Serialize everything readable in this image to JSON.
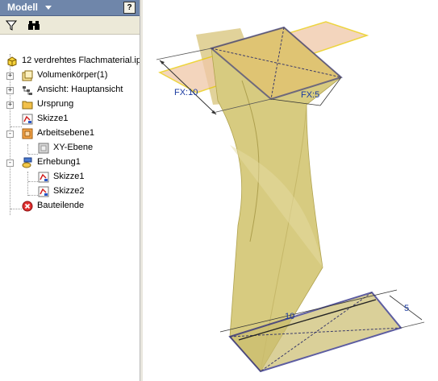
{
  "panel": {
    "title": "Modell",
    "help_label": "?",
    "toolbar": {
      "filter_icon": "filter-icon",
      "find_icon": "binoculars-icon"
    }
  },
  "tree": {
    "root": "12 verdrehtes Flachmaterial.ipt",
    "items": [
      {
        "label": "Volumenkörper(1)",
        "icon": "solid-bodies-icon",
        "expander": "+"
      },
      {
        "label": "Ansicht: Hauptansicht",
        "icon": "view-icon",
        "expander": "+"
      },
      {
        "label": "Ursprung",
        "icon": "origin-folder-icon",
        "expander": "+"
      },
      {
        "label": "Skizze1",
        "icon": "sketch-icon",
        "expander": ""
      },
      {
        "label": "Arbeitsebene1",
        "icon": "work-plane-icon",
        "expander": "-"
      },
      {
        "label": "XY-Ebene",
        "icon": "plane-icon",
        "expander": ""
      },
      {
        "label": "Erhebung1",
        "icon": "loft-icon",
        "expander": "-"
      },
      {
        "label": "Skizze1",
        "icon": "sketch-icon",
        "expander": ""
      },
      {
        "label": "Skizze2",
        "icon": "sketch-icon",
        "expander": ""
      },
      {
        "label": "Bauteilende",
        "icon": "end-of-part-icon",
        "expander": ""
      }
    ]
  },
  "viewport": {
    "dimensions": {
      "top_length": "FX:10",
      "top_width": "FX:5",
      "bottom_length": "10",
      "bottom_width": "5"
    }
  },
  "colors": {
    "header_bg": "#6f86aa",
    "loft_fill": "#d2c77c",
    "sketch_plane": "#f0c8a8",
    "edge_blue": "#1a1a7a"
  }
}
